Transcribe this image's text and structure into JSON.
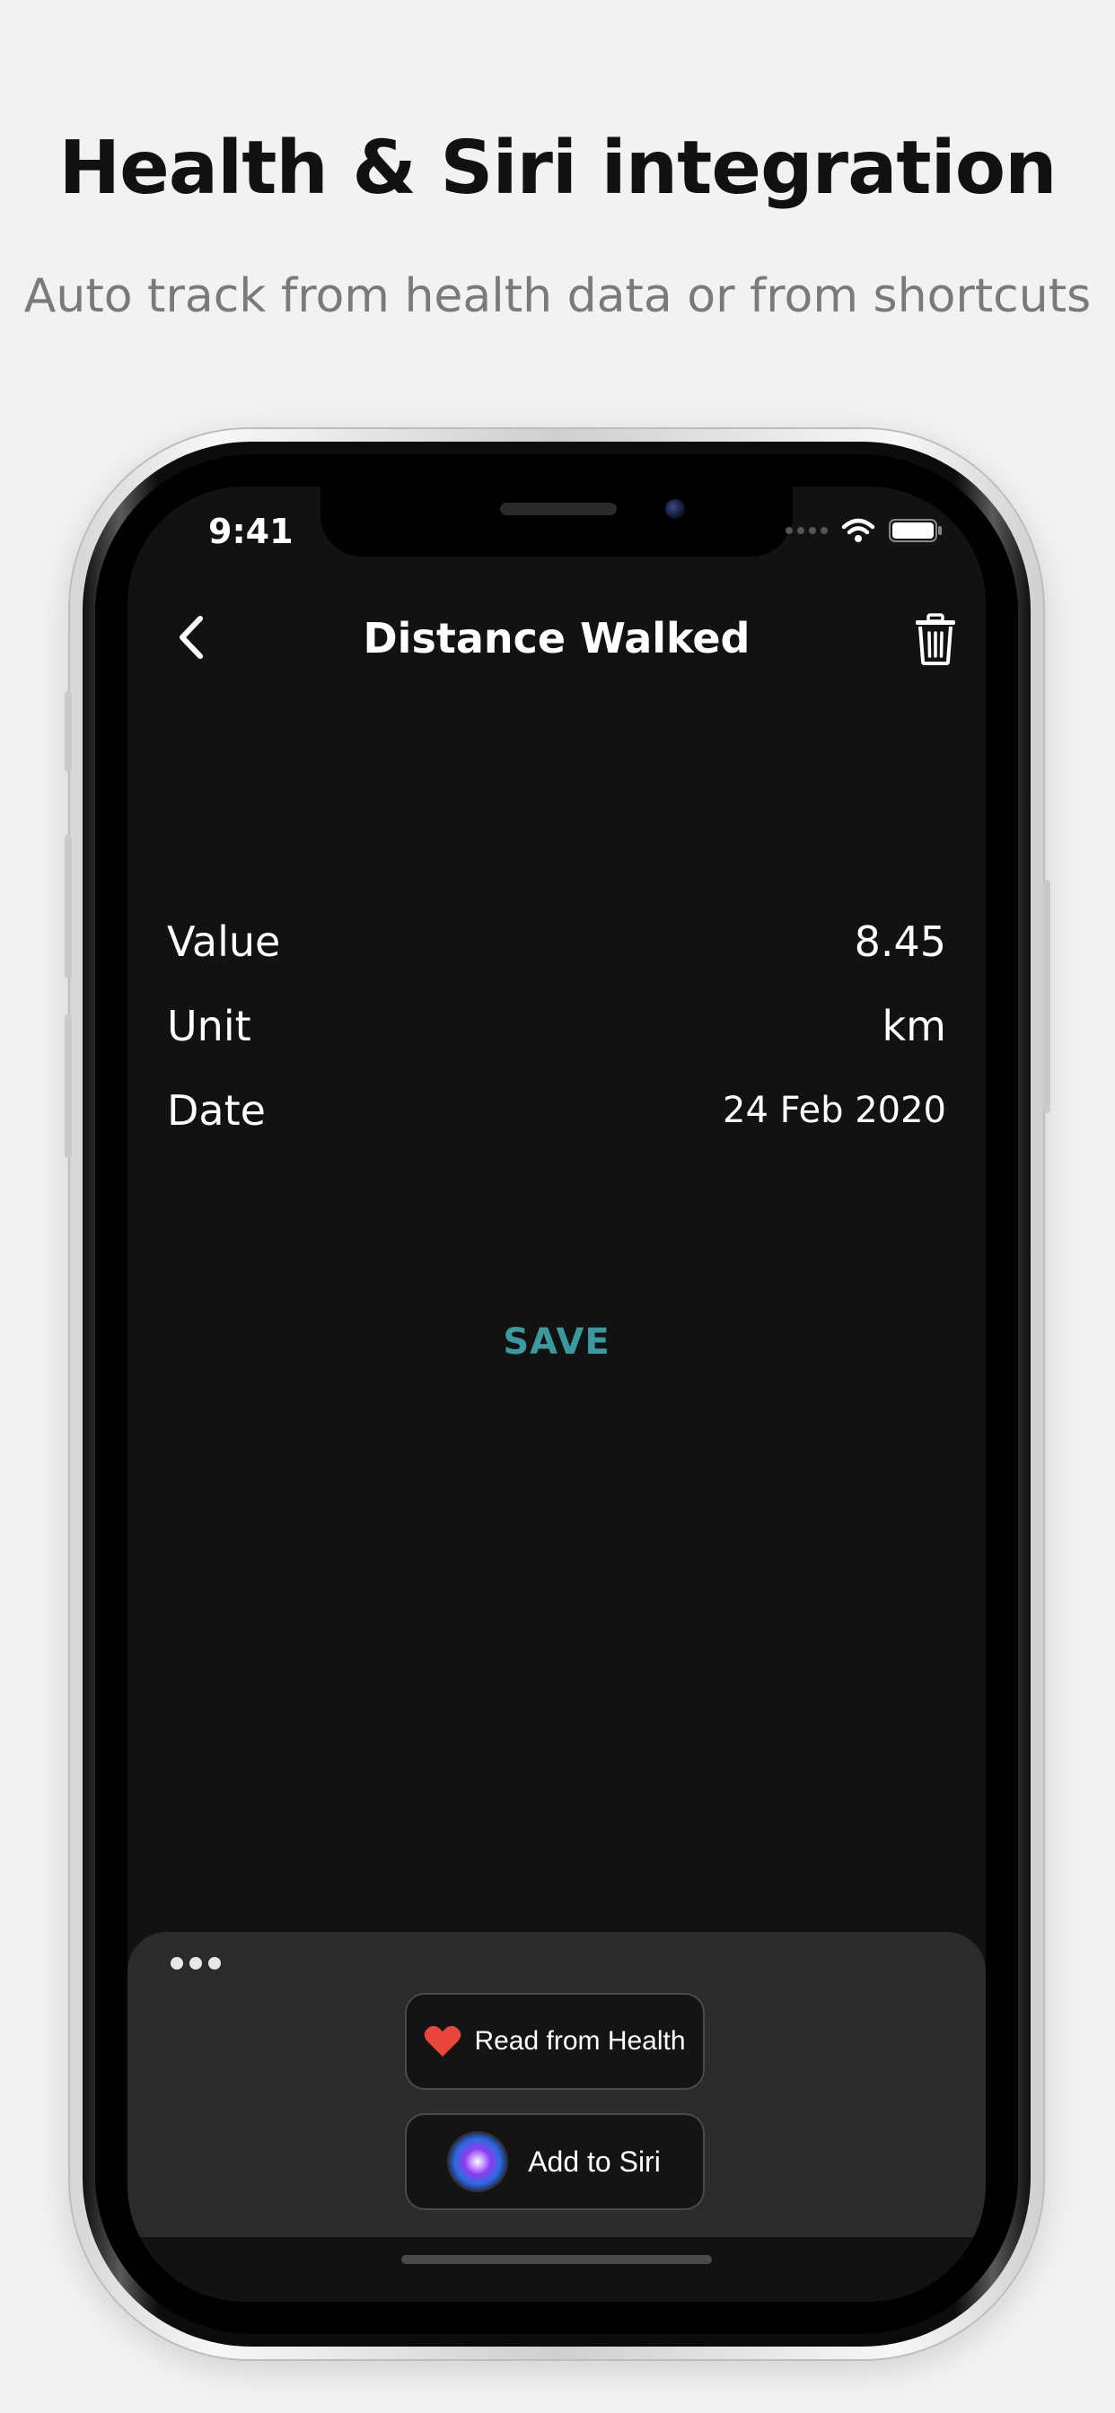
{
  "promo": {
    "headline": "Health & Siri integration",
    "subhead": "Auto track from health data or from shortcuts"
  },
  "status_bar": {
    "time": "9:41",
    "icons": [
      "signal-dots-icon",
      "wifi-icon",
      "battery-icon"
    ]
  },
  "nav": {
    "title": "Distance Walked",
    "back_icon": "chevron-left-icon",
    "delete_icon": "trash-icon"
  },
  "fields": [
    {
      "label": "Value",
      "value": "8.45"
    },
    {
      "label": "Unit",
      "value": "km"
    },
    {
      "label": "Date",
      "value": "24 Feb 2020"
    }
  ],
  "save_label": "SAVE",
  "panel": {
    "more_icon": "more-dots-icon",
    "read_health_label": "Read from Health",
    "add_siri_label": "Add to Siri"
  },
  "colors": {
    "background": "#f2f2f2",
    "screen": "#121212",
    "accent": "#3a9a9d",
    "panel": "#2b2b2b",
    "heart": "#e8453c"
  }
}
